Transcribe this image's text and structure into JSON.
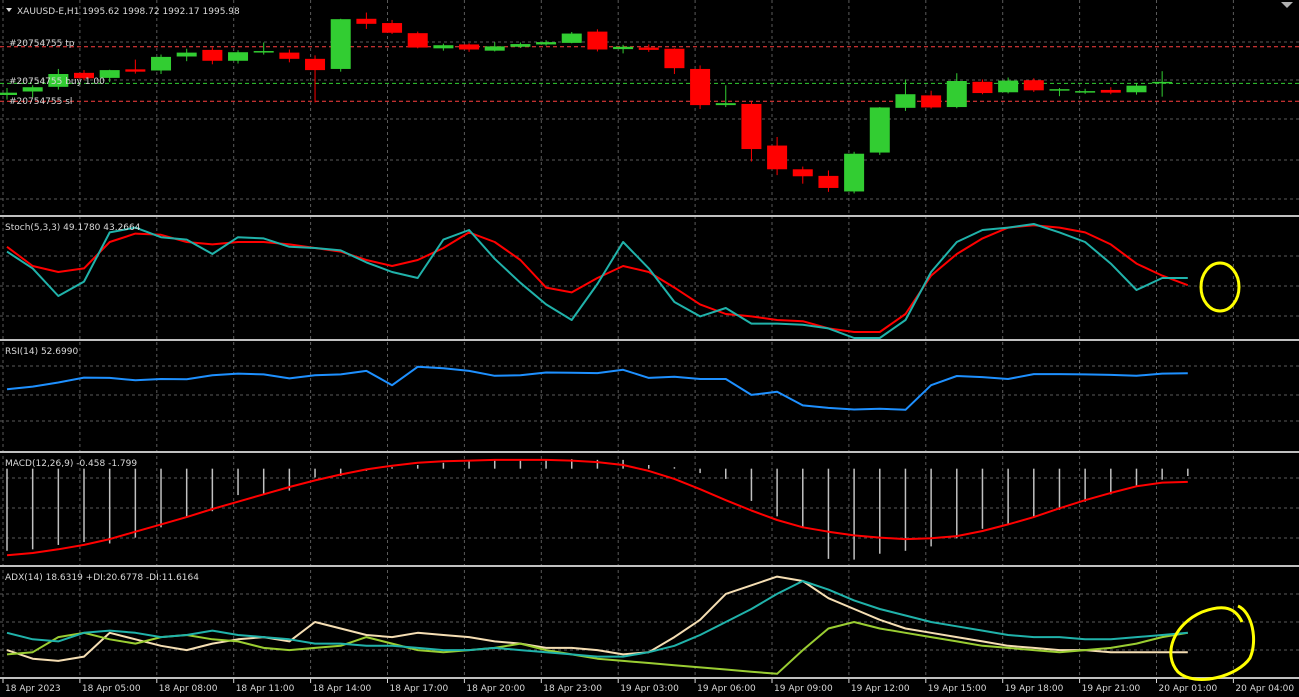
{
  "colors": {
    "background": "#000000",
    "grid": "#5a5a5a",
    "separator": "#c0c0c0",
    "text": "#d8d8d8",
    "bull": "#32cd32",
    "bear": "#ff0000",
    "stoch_main": "#20b2aa",
    "stoch_signal": "#ff0000",
    "rsi": "#1e90ff",
    "macd_hist": "#c0c0c0",
    "macd_signal": "#ff0000",
    "adx": "#20b2aa",
    "plus_di": "#9acd32",
    "minus_di": "#f5deb3",
    "annotation": "#ffff00",
    "tp_line": "#ff4040",
    "sl_line": "#ff4040",
    "entry_line": "#32cd32"
  },
  "header": {
    "symbol_line": "XAUUSD-E,H1  1995.62 1998.72 1992.17 1995.98",
    "collapse_icon": "triangle-down-icon"
  },
  "trade_lines": {
    "tp": "#20754755 tp",
    "entry": "#20754755 buy 1.00",
    "sl": "#20754755 sl"
  },
  "indicators": {
    "stoch": "Stoch(5,3,3) 49.1780 43.2664",
    "rsi": "RSI(14) 52.6990",
    "macd": "MACD(12,26,9) -0.458 -1.799",
    "adx": "ADX(14) 18.6319 +DI:20.6778 -DI:11.6164"
  },
  "time_axis": {
    "labels": [
      "18 Apr 2023",
      "18 Apr 05:00",
      "18 Apr 08:00",
      "18 Apr 11:00",
      "18 Apr 14:00",
      "18 Apr 17:00",
      "18 Apr 20:00",
      "18 Apr 23:00",
      "19 Apr 03:00",
      "19 Apr 06:00",
      "19 Apr 09:00",
      "19 Apr 12:00",
      "19 Apr 15:00",
      "19 Apr 18:00",
      "19 Apr 21:00",
      "20 Apr 01:00",
      "20 Apr 04:00"
    ]
  },
  "chart_data": [
    {
      "type": "candlestick",
      "symbol": "XAUUSD-E",
      "timeframe": "H1",
      "last_bar": {
        "open": 1995.62,
        "high": 1998.72,
        "low": 1992.17,
        "close": 1995.98
      },
      "levels": {
        "tp": 2005.0,
        "entry": 1995.6,
        "sl": 1991.0
      },
      "ylim": [
        1962,
        2016
      ],
      "ohlc": [
        [
          1992.6,
          1994.4,
          1991.4,
          1993.2
        ],
        [
          1993.5,
          1995.1,
          1992.0,
          1994.6
        ],
        [
          1994.7,
          1999.3,
          1994.0,
          1998.0
        ],
        [
          1998.3,
          1999.0,
          1996.4,
          1996.9
        ],
        [
          1997.0,
          1999.1,
          1995.9,
          1999.0
        ],
        [
          1999.2,
          2001.7,
          1998.1,
          1998.6
        ],
        [
          1998.9,
          2003.0,
          1998.0,
          2002.4
        ],
        [
          2002.5,
          2004.5,
          2001.3,
          2003.5
        ],
        [
          2004.2,
          2004.8,
          2000.5,
          2001.4
        ],
        [
          2001.4,
          2004.1,
          2000.7,
          2003.6
        ],
        [
          2003.8,
          2006.1,
          2003.0,
          2003.9
        ],
        [
          2003.5,
          2004.3,
          2001.0,
          2001.9
        ],
        [
          2001.9,
          2002.8,
          1990.7,
          1999.0
        ],
        [
          1999.3,
          2012.2,
          1998.6,
          2012.1
        ],
        [
          2012.2,
          2013.8,
          2009.6,
          2010.9
        ],
        [
          2011.1,
          2011.9,
          2008.3,
          2008.6
        ],
        [
          2008.5,
          2008.9,
          2004.6,
          2004.8
        ],
        [
          2004.6,
          2005.8,
          2004.0,
          2005.4
        ],
        [
          2005.6,
          2005.9,
          2003.7,
          2004.3
        ],
        [
          2004.0,
          2006.2,
          2003.8,
          2005.1
        ],
        [
          2005.0,
          2006.1,
          2004.7,
          2005.7
        ],
        [
          2005.6,
          2006.7,
          2005.3,
          2006.2
        ],
        [
          2006.0,
          2008.8,
          2005.9,
          2008.4
        ],
        [
          2008.9,
          2009.5,
          2003.8,
          2004.3
        ],
        [
          2004.4,
          2005.5,
          2003.3,
          2005.0
        ],
        [
          2004.8,
          2005.6,
          2003.7,
          2004.2
        ],
        [
          2004.5,
          2004.6,
          1998.0,
          1999.5
        ],
        [
          1999.3,
          2000.2,
          1989.0,
          1990.0
        ],
        [
          1990.0,
          1995.1,
          1989.5,
          1990.5
        ],
        [
          1990.3,
          1991.0,
          1975.5,
          1978.7
        ],
        [
          1979.6,
          1981.8,
          1972.0,
          1973.5
        ],
        [
          1973.5,
          1974.2,
          1969.8,
          1971.7
        ],
        [
          1971.8,
          1973.2,
          1967.7,
          1968.7
        ],
        [
          1967.8,
          1978.0,
          1967.3,
          1977.5
        ],
        [
          1977.8,
          1989.5,
          1977.2,
          1989.4
        ],
        [
          1989.3,
          1996.6,
          1988.5,
          1992.8
        ],
        [
          1992.5,
          1993.7,
          1989.1,
          1989.4
        ],
        [
          1989.5,
          1998.2,
          1989.2,
          1996.2
        ],
        [
          1996.0,
          1996.6,
          1992.8,
          1993.1
        ],
        [
          1993.3,
          1997.1,
          1993.0,
          1996.3
        ],
        [
          1996.4,
          1996.9,
          1993.4,
          1993.8
        ],
        [
          1993.8,
          1994.4,
          1992.3,
          1994.1
        ],
        [
          1993.5,
          1994.2,
          1992.9,
          1993.6
        ],
        [
          1993.9,
          1994.6,
          1992.8,
          1993.2
        ],
        [
          1993.3,
          1995.6,
          1992.7,
          1995.0
        ],
        [
          1995.62,
          1998.72,
          1992.17,
          1995.98
        ]
      ]
    },
    {
      "type": "line",
      "name": "Stoch(5,3,3)",
      "ylim": [
        0,
        100
      ],
      "series": [
        {
          "name": "main",
          "values": [
            72,
            58,
            35,
            47,
            88,
            92,
            84,
            82,
            70,
            84,
            83,
            76,
            75,
            73,
            63,
            55,
            50,
            82,
            90,
            66,
            46,
            28,
            15,
            45,
            80,
            58,
            30,
            18,
            25,
            12,
            12,
            11,
            8,
            0,
            0,
            15,
            55,
            80,
            90,
            92,
            95,
            88,
            80,
            62,
            40,
            50,
            50
          ]
        },
        {
          "name": "signal",
          "values": [
            76,
            60,
            55,
            58,
            80,
            87,
            86,
            80,
            78,
            80,
            80,
            78,
            75,
            72,
            65,
            60,
            65,
            75,
            88,
            80,
            65,
            42,
            38,
            50,
            60,
            55,
            42,
            28,
            20,
            18,
            15,
            14,
            8,
            5,
            5,
            20,
            52,
            70,
            83,
            92,
            94,
            92,
            88,
            78,
            62,
            52,
            44
          ]
        }
      ]
    },
    {
      "type": "line",
      "name": "RSI(14)",
      "ylim": [
        30,
        70
      ],
      "series": [
        {
          "name": "RSI",
          "values": [
            52.5,
            53.5,
            55.0,
            56.8,
            56.7,
            55.8,
            56.3,
            56.2,
            57.7,
            58.3,
            58.0,
            56.5,
            57.7,
            58.0,
            59.3,
            54.0,
            60.8,
            60.3,
            59.3,
            57.5,
            57.7,
            58.7,
            58.6,
            58.5,
            59.7,
            56.7,
            57.1,
            56.3,
            56.3,
            50.4,
            51.6,
            46.5,
            45.6,
            45.0,
            45.3,
            44.9,
            54.0,
            57.4,
            57.0,
            56.3,
            58.1,
            58.1,
            58.0,
            57.8,
            57.5,
            58.3,
            58.4
          ]
        }
      ]
    },
    {
      "type": "bar+line",
      "name": "MACD(12,26,9)",
      "ylim": [
        -13,
        2
      ],
      "series": [
        {
          "name": "histogram",
          "values": [
            -11.2,
            -11.0,
            -10.4,
            -10.0,
            -10.2,
            -9.4,
            -8.0,
            -6.5,
            -5.8,
            -3.6,
            -3.5,
            -3.0,
            -1.2,
            -1.0,
            -0.3,
            0.2,
            0.5,
            0.8,
            1.0,
            1.1,
            1.1,
            1.2,
            1.3,
            1.2,
            1.2,
            0.5,
            0.2,
            -0.6,
            -1.4,
            -4.4,
            -6.5,
            -8.1,
            -12.3,
            -12.4,
            -11.6,
            -11.2,
            -10.6,
            -9.5,
            -8.2,
            -7.5,
            -6.6,
            -5.6,
            -4.5,
            -3.5,
            -2.5,
            -1.5,
            -1.0
          ]
        },
        {
          "name": "signal",
          "values": [
            -11.8,
            -11.5,
            -11.0,
            -10.4,
            -9.6,
            -8.6,
            -7.6,
            -6.6,
            -5.5,
            -4.5,
            -3.5,
            -2.5,
            -1.6,
            -0.8,
            -0.1,
            0.4,
            0.8,
            1.0,
            1.1,
            1.2,
            1.2,
            1.2,
            1.1,
            0.9,
            0.5,
            -0.3,
            -1.4,
            -2.8,
            -4.3,
            -5.7,
            -7.0,
            -8.0,
            -8.6,
            -9.1,
            -9.4,
            -9.6,
            -9.5,
            -9.2,
            -8.5,
            -7.6,
            -6.6,
            -5.4,
            -4.3,
            -3.3,
            -2.4,
            -1.9,
            -1.8
          ]
        }
      ]
    },
    {
      "type": "line",
      "name": "ADX(14)",
      "ylim": [
        0,
        50
      ],
      "series": [
        {
          "name": "ADX",
          "values": [
            20,
            17,
            16,
            20,
            21,
            20,
            18,
            19,
            21,
            19,
            18,
            17,
            15,
            15,
            14,
            14,
            13,
            12,
            12,
            13,
            12,
            11,
            10,
            9,
            9,
            11,
            14,
            19,
            25,
            31,
            38,
            44,
            40,
            35,
            31,
            28,
            25,
            23,
            21,
            19,
            18,
            18,
            17,
            17,
            18,
            19,
            20
          ]
        },
        {
          "name": "+DI",
          "values": [
            10,
            11,
            18,
            20,
            17,
            15,
            18,
            19,
            17,
            16,
            13,
            12,
            13,
            14,
            18,
            15,
            12,
            11,
            12,
            13,
            15,
            12,
            10,
            8,
            7,
            6,
            5,
            4,
            3,
            2,
            1,
            12,
            22,
            25,
            22,
            20,
            18,
            16,
            14,
            13,
            12,
            11,
            12,
            13,
            15,
            18,
            20
          ]
        },
        {
          "name": "-DI",
          "values": [
            12,
            8,
            7,
            9,
            20,
            17,
            14,
            12,
            15,
            17,
            18,
            16,
            25,
            22,
            19,
            18,
            20,
            19,
            18,
            16,
            15,
            13,
            13,
            12,
            10,
            11,
            18,
            26,
            38,
            42,
            46,
            44,
            36,
            31,
            26,
            22,
            20,
            18,
            16,
            14,
            13,
            12,
            12,
            11,
            11,
            11,
            11
          ]
        }
      ]
    }
  ]
}
